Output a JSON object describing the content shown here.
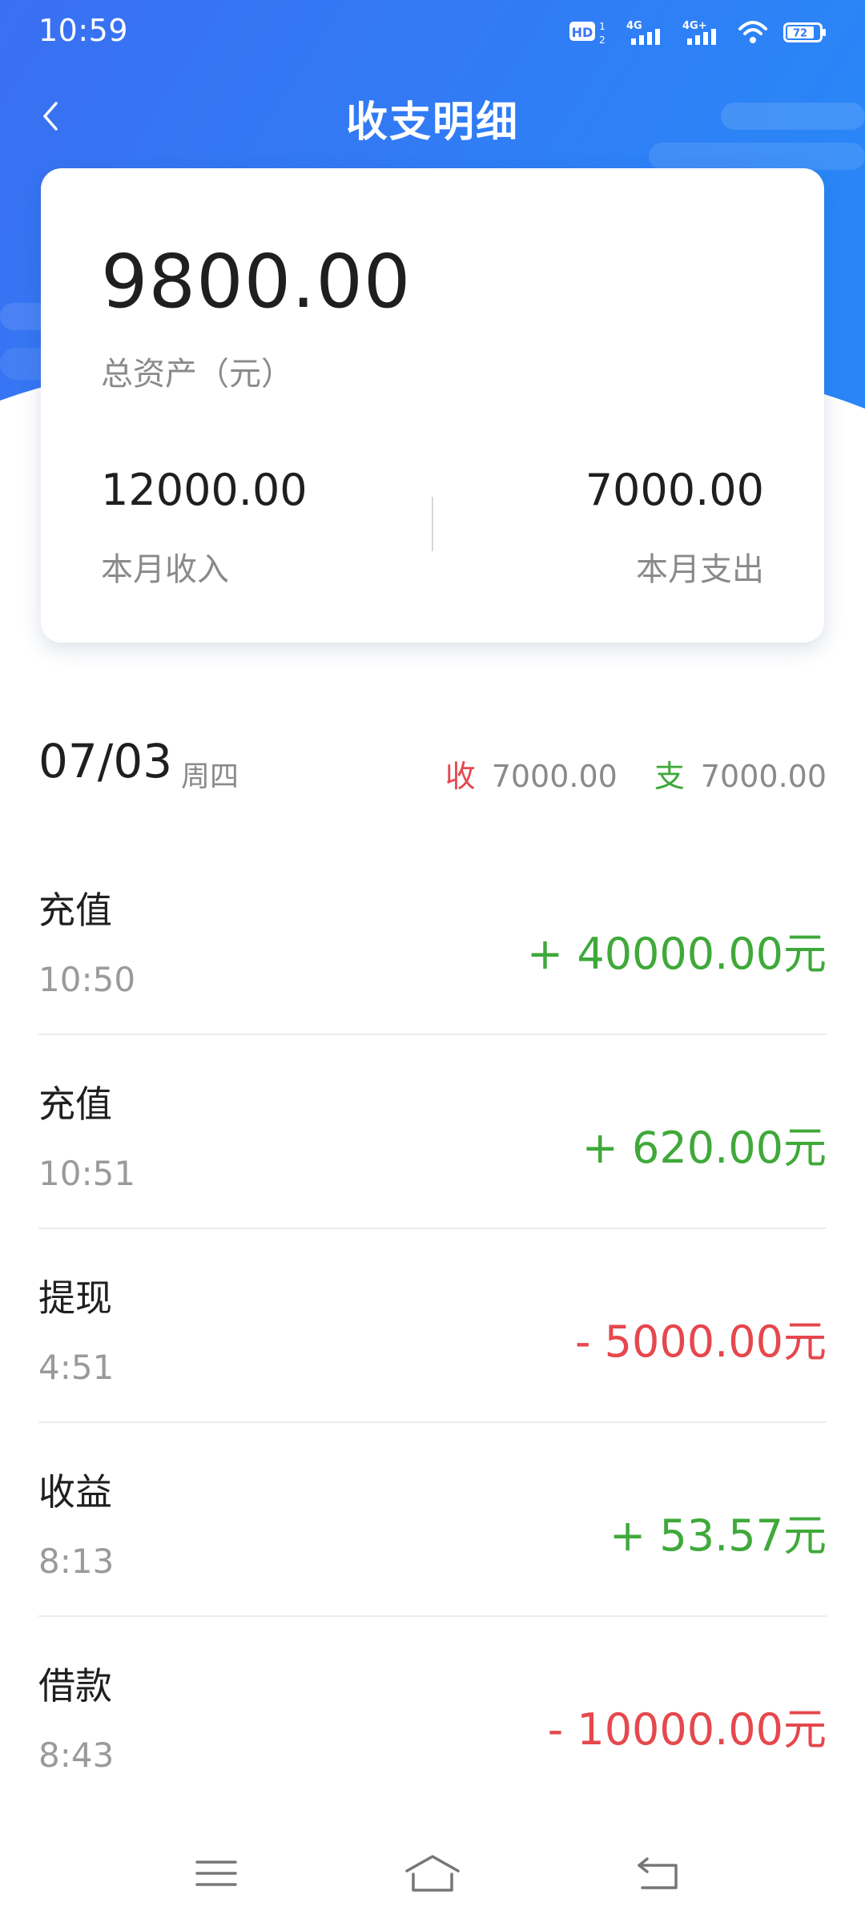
{
  "status_bar": {
    "time": "10:59",
    "battery": "72",
    "network_1": "4G",
    "network_2": "4G+",
    "hd": "HD"
  },
  "header": {
    "title": "收支明细",
    "back_icon": "chevron-left-icon",
    "background_color": "#2f7df5"
  },
  "summary": {
    "total_amount": "9800.00",
    "total_label": "总资产（元）",
    "income_amount": "12000.00",
    "income_label": "本月收入",
    "expense_amount": "7000.00",
    "expense_label": "本月支出"
  },
  "day": {
    "date": "07/03",
    "weekday": "周四",
    "income_tag": "收",
    "income_value": "7000.00",
    "expense_tag": "支",
    "expense_value": "7000.00"
  },
  "transactions": [
    {
      "name": "充值",
      "time": "10:50",
      "amount": "+ 40000.00元",
      "type": "income"
    },
    {
      "name": "充值",
      "time": "10:51",
      "amount": "+ 620.00元",
      "type": "income"
    },
    {
      "name": "提现",
      "time": "4:51",
      "amount": "- 5000.00元",
      "type": "expense"
    },
    {
      "name": "收益",
      "time": "8:13",
      "amount": "+ 53.57元",
      "type": "income"
    },
    {
      "name": "借款",
      "time": "8:43",
      "amount": "- 10000.00元",
      "type": "expense"
    }
  ],
  "colors": {
    "income": "#3fa93a",
    "expense": "#e5484d",
    "primary": "#2f7df5"
  },
  "system_nav": {
    "menu_icon": "menu-icon",
    "home_icon": "home-icon",
    "back_icon": "back-arrow-icon"
  }
}
